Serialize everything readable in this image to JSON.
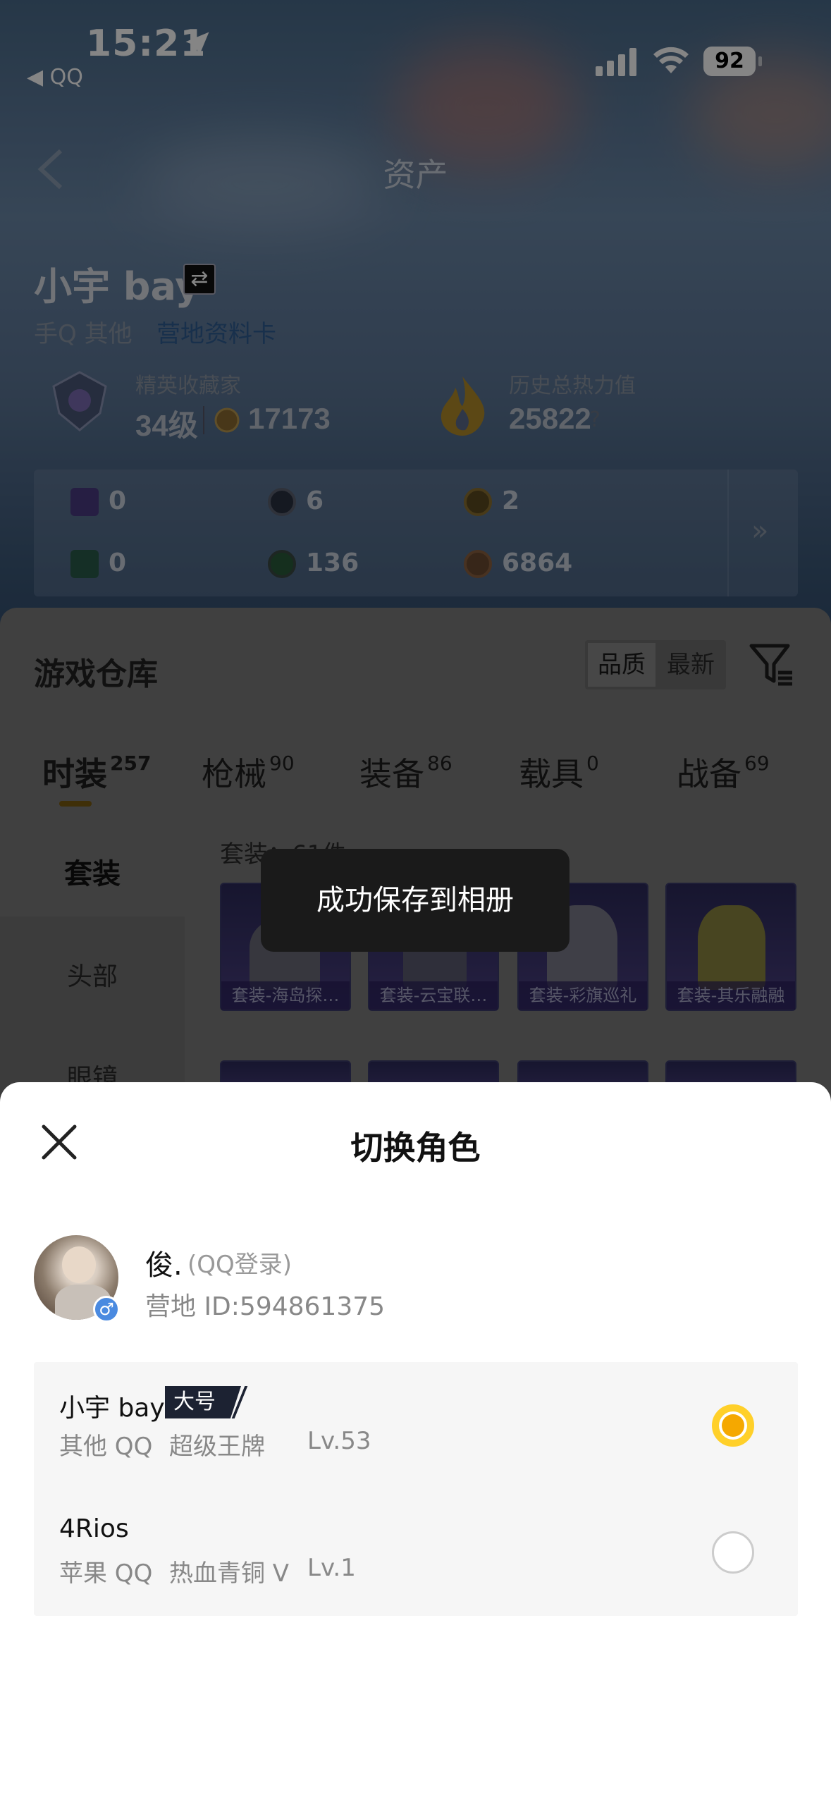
{
  "status_bar": {
    "time": "15:21",
    "back_app": "◀ QQ",
    "battery": "92"
  },
  "nav": {
    "title": "资产"
  },
  "profile": {
    "username": "小宇 bay",
    "platform": "手Q 其他",
    "link_text": "营地资料卡",
    "collector_label": "精英收藏家",
    "collector_level": "34级",
    "collector_points": "17173",
    "heat_label": "历史总热力值",
    "heat_value": "25822",
    "heat_help": "?"
  },
  "resources": [
    {
      "name": "purple-card-icon",
      "value": "0"
    },
    {
      "name": "coin-dark-icon",
      "value": "6"
    },
    {
      "name": "coin-gold-icon",
      "value": "2"
    },
    {
      "name": "green-card-icon",
      "value": "0"
    },
    {
      "name": "green-orb-icon",
      "value": "136"
    },
    {
      "name": "bronze-coin-icon",
      "value": "6864"
    }
  ],
  "resources_more": "»",
  "warehouse": {
    "title": "游戏仓库",
    "sort": [
      "品质",
      "最新"
    ],
    "categories": [
      {
        "label": "时装",
        "count": "257"
      },
      {
        "label": "枪械",
        "count": "90"
      },
      {
        "label": "装备",
        "count": "86"
      },
      {
        "label": "载具",
        "count": "0"
      },
      {
        "label": "战备",
        "count": "69"
      }
    ],
    "side_items": [
      "套装",
      "头部",
      "眼镜"
    ],
    "suit_count": "套装：61件",
    "items": [
      "套装-海岛探…",
      "套装-云宝联…",
      "套装-彩旗巡礼",
      "套装-其乐融融"
    ]
  },
  "toast": "成功保存到相册",
  "modal": {
    "title": "切换角色",
    "account_name": "俊.",
    "account_login": "(QQ登录)",
    "account_id": "营地 ID:594861375",
    "gender": "♂",
    "roles": [
      {
        "name": "小宇 bay",
        "tag": "大号",
        "meta": [
          "其他 QQ",
          "超级王牌",
          "Lv.53"
        ],
        "selected": true
      },
      {
        "name": "4Rios",
        "tag": "",
        "meta": [
          "苹果 QQ",
          "热血青铜 V",
          "Lv.1"
        ],
        "selected": false
      }
    ]
  },
  "colors": {
    "accent": "#f5a800",
    "toast_bg": "#1a1a1a",
    "tag_bg": "#1c2232"
  }
}
